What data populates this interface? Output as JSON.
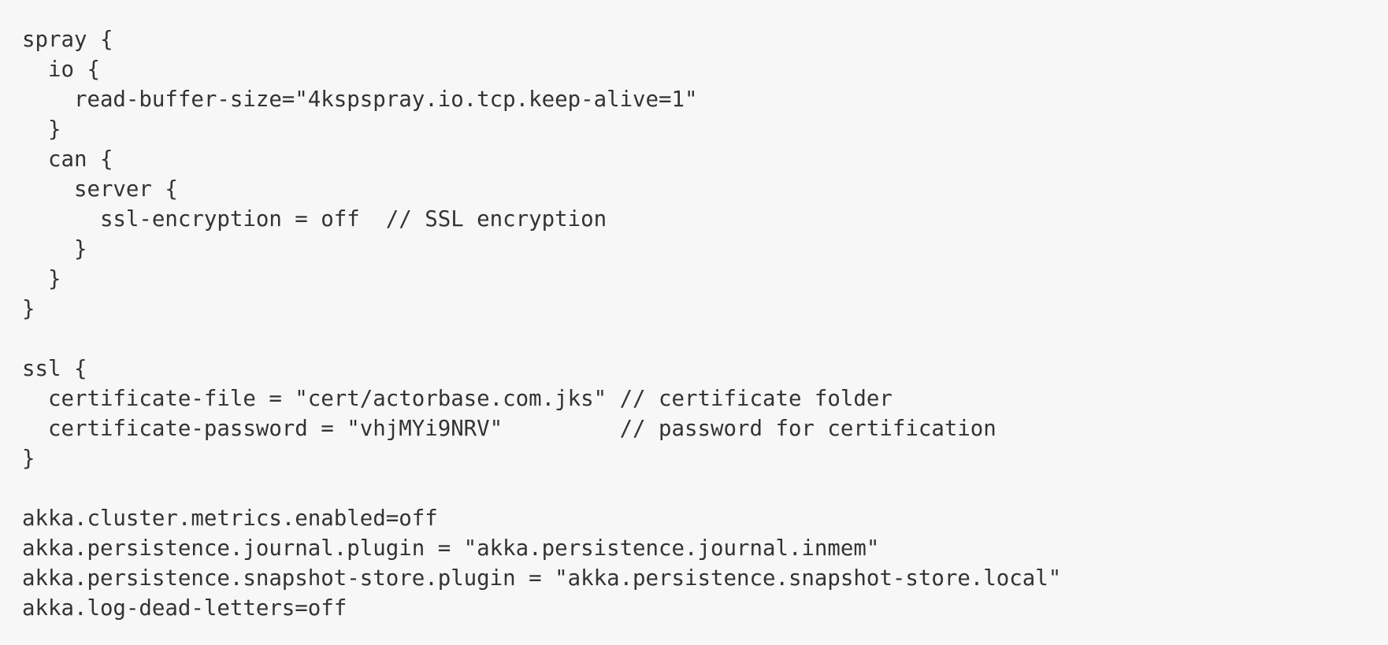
{
  "code": {
    "lines": [
      "spray {",
      "  io {",
      "    read-buffer-size=\"4kspspray.io.tcp.keep-alive=1\"",
      "  }",
      "  can {",
      "    server {",
      "      ssl-encryption = off  // SSL encryption",
      "    }",
      "  }",
      "}",
      "",
      "ssl {",
      "  certificate-file = \"cert/actorbase.com.jks\" // certificate folder",
      "  certificate-password = \"vhjMYi9NRV\"         // password for certification",
      "}",
      "",
      "akka.cluster.metrics.enabled=off",
      "akka.persistence.journal.plugin = \"akka.persistence.journal.inmem\"",
      "akka.persistence.snapshot-store.plugin = \"akka.persistence.snapshot-store.local\"",
      "akka.log-dead-letters=off"
    ]
  }
}
